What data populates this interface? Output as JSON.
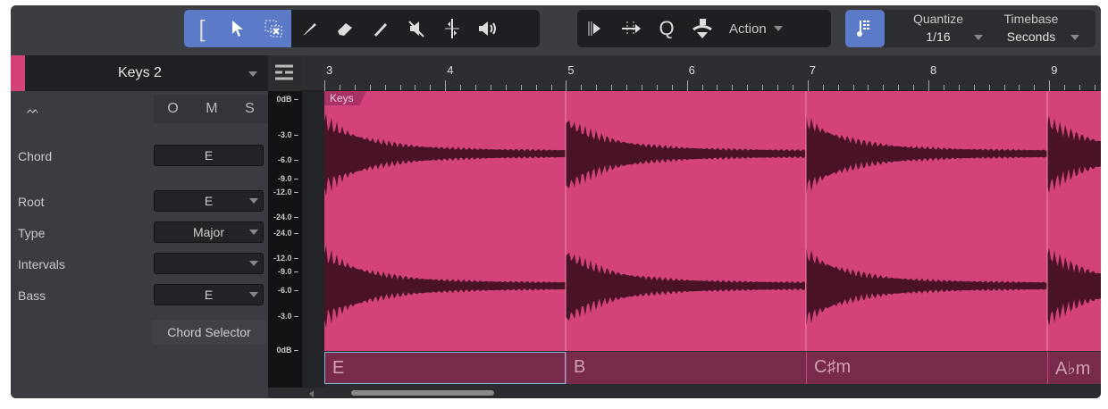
{
  "toolbar": {
    "tools": [
      "range-tool",
      "arrow-tool",
      "split-select-tool",
      "knife-tool",
      "eraser-tool",
      "pencil-tool",
      "mute-tool",
      "bend-tool",
      "listen-tool"
    ],
    "action_label": "Action",
    "quantize_label": "Quantize",
    "quantize_value": "1/16",
    "timebase_label": "Timebase",
    "timebase_value": "Seconds"
  },
  "track": {
    "name": "Keys 2",
    "color": "#d3437a",
    "buttons": [
      "O",
      "M",
      "S"
    ],
    "fields": [
      {
        "label": "Chord",
        "value": "E"
      },
      {
        "label": "Root",
        "value": "E"
      },
      {
        "label": "Type",
        "value": "Major"
      },
      {
        "label": "Intervals",
        "value": ""
      },
      {
        "label": "Bass",
        "value": "E"
      }
    ],
    "chord_selector": "Chord Selector"
  },
  "meter": {
    "ticks": [
      "0dB",
      "-3.0",
      "-6.0",
      "-9.0",
      "-12.0",
      "-24.0",
      "-24.0",
      "-12.0",
      "-9.0",
      "-6.0",
      "-3.0",
      "0dB"
    ]
  },
  "ruler": {
    "bars": [
      "3",
      "4",
      "5",
      "6",
      "7",
      "8",
      "9"
    ]
  },
  "clip": {
    "name": "Keys"
  },
  "chords": [
    "E",
    "B",
    "C♯m",
    "A♭m"
  ]
}
